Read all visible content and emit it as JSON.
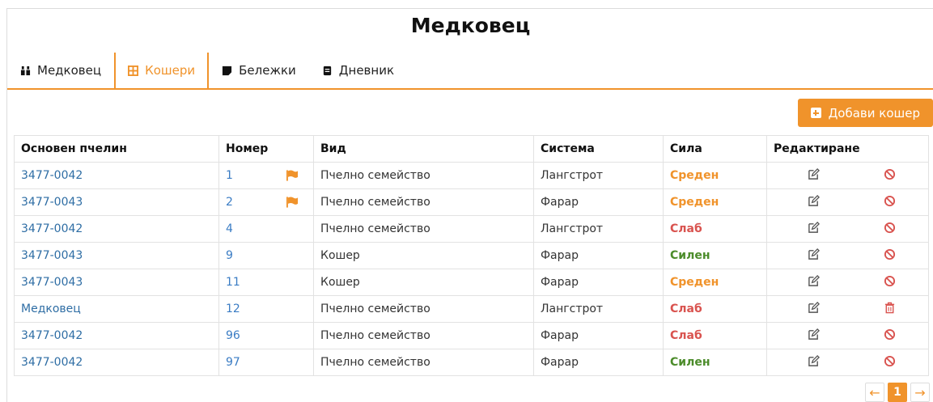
{
  "app_title": "Медковец",
  "nav": {
    "tabs": [
      {
        "label": "Медковец",
        "icon": "apiary-icon",
        "active": false
      },
      {
        "label": "Кошери",
        "icon": "grid-icon",
        "active": true
      },
      {
        "label": "Бележки",
        "icon": "note-icon",
        "active": false
      },
      {
        "label": "Дневник",
        "icon": "book-icon",
        "active": false
      }
    ]
  },
  "toolbar": {
    "add_label": "Добави кошер"
  },
  "table": {
    "headers": [
      "Основен пчелин",
      "Номер",
      "Вид",
      "Система",
      "Сила",
      "Редактиране"
    ],
    "rows": [
      {
        "apiary": "3477-0042",
        "number": "1",
        "flag": true,
        "type": "Пчелно семейство",
        "system": "Лангстрот",
        "strength": "Среден",
        "strength_level": "medium",
        "delete_icon": "ban-icon"
      },
      {
        "apiary": "3477-0043",
        "number": "2",
        "flag": true,
        "type": "Пчелно семейство",
        "system": "Фарар",
        "strength": "Среден",
        "strength_level": "medium",
        "delete_icon": "ban-icon"
      },
      {
        "apiary": "3477-0042",
        "number": "4",
        "flag": false,
        "type": "Пчелно семейство",
        "system": "Лангстрот",
        "strength": "Слаб",
        "strength_level": "weak",
        "delete_icon": "ban-icon"
      },
      {
        "apiary": "3477-0043",
        "number": "9",
        "flag": false,
        "type": "Кошер",
        "system": "Фарар",
        "strength": "Силен",
        "strength_level": "strong",
        "delete_icon": "ban-icon"
      },
      {
        "apiary": "3477-0043",
        "number": "11",
        "flag": false,
        "type": "Кошер",
        "system": "Фарар",
        "strength": "Среден",
        "strength_level": "medium",
        "delete_icon": "ban-icon"
      },
      {
        "apiary": "Медковец",
        "number": "12",
        "flag": false,
        "type": "Пчелно семейство",
        "system": "Лангстрот",
        "strength": "Слаб",
        "strength_level": "weak",
        "delete_icon": "trash-icon"
      },
      {
        "apiary": "3477-0042",
        "number": "96",
        "flag": false,
        "type": "Пчелно семейство",
        "system": "Фарар",
        "strength": "Слаб",
        "strength_level": "weak",
        "delete_icon": "ban-icon"
      },
      {
        "apiary": "3477-0042",
        "number": "97",
        "flag": false,
        "type": "Пчелно семейство",
        "system": "Фарар",
        "strength": "Силен",
        "strength_level": "strong",
        "delete_icon": "ban-icon"
      }
    ]
  },
  "pagination": {
    "prev": "←",
    "current": "1",
    "next": "→"
  },
  "colors": {
    "accent": "#f0932b",
    "link": "#2e6da4",
    "weak": "#d9534f",
    "strong": "#4c8c2b"
  }
}
